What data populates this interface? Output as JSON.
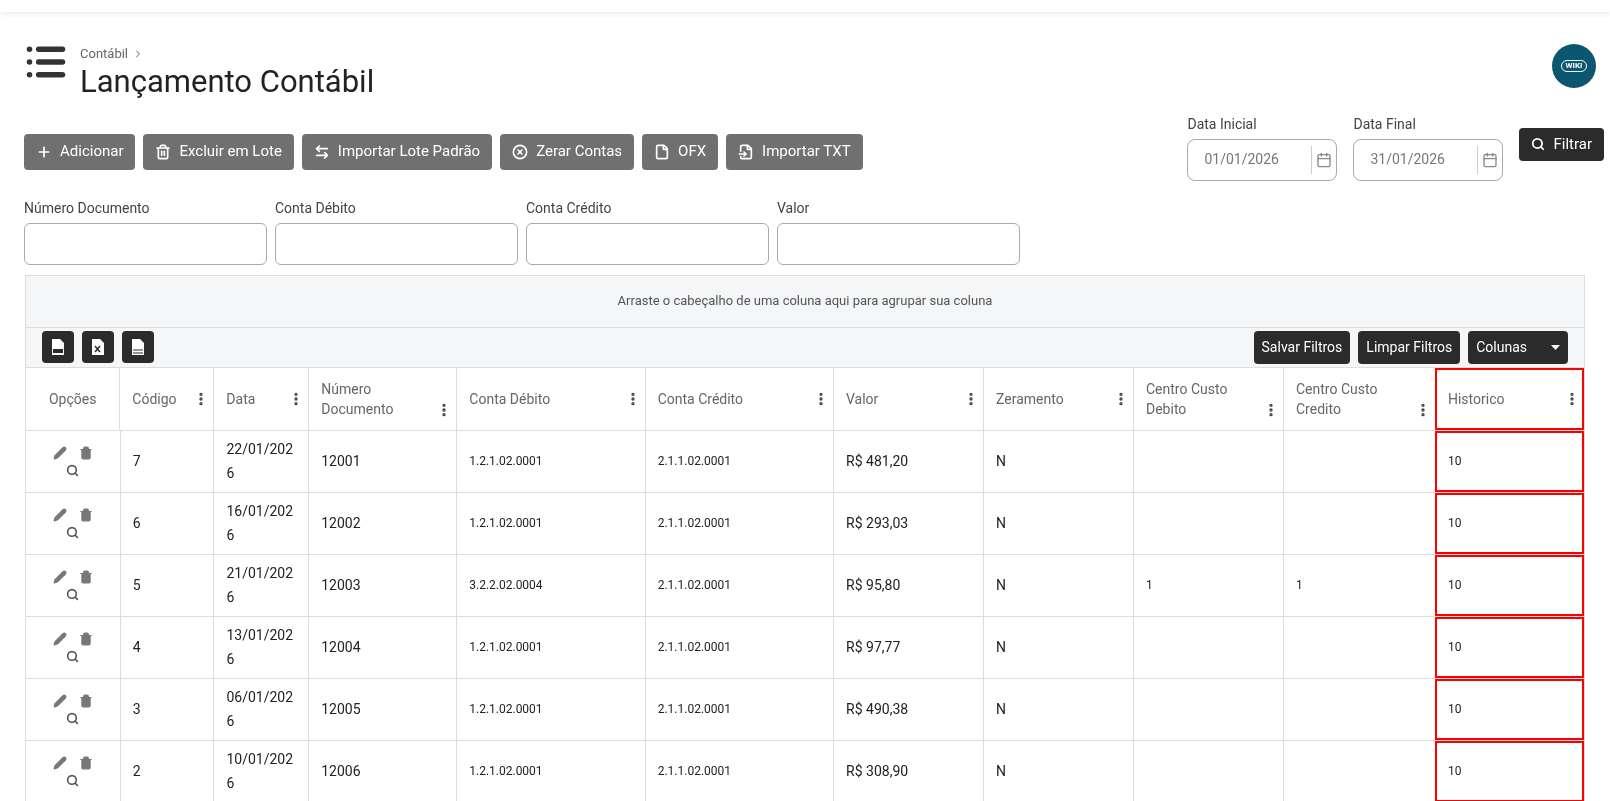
{
  "wiki_logo": "WIKI",
  "breadcrumb": "Contábil",
  "title": "Lançamento Contábil",
  "actions": [
    {
      "label": "Adicionar",
      "kind": "plus"
    },
    {
      "label": "Excluir em Lote",
      "kind": "trash"
    },
    {
      "label": "Importar Lote Padrão",
      "kind": "swap"
    },
    {
      "label": "Zerar Contas",
      "kind": "clear"
    },
    {
      "label": "OFX",
      "kind": "file"
    },
    {
      "label": "Importar TXT",
      "kind": "import"
    }
  ],
  "date_filters": [
    {
      "label": "Data Inicial",
      "value": "01/01/2026"
    },
    {
      "label": "Data Final",
      "value": "31/01/2026"
    }
  ],
  "filter_button": "Filtrar",
  "filters": [
    {
      "label": "Número Documento"
    },
    {
      "label": "Conta Débito"
    },
    {
      "label": "Conta Crédito"
    },
    {
      "label": "Valor"
    }
  ],
  "group_hint": "Arraste o cabeçalho de uma coluna aqui para agrupar sua coluna",
  "exports": [
    {
      "kind": "pdf"
    },
    {
      "kind": "xls"
    },
    {
      "kind": "csv"
    }
  ],
  "grid_buttons": [
    "Salvar Filtros",
    "Limpar Filtros"
  ],
  "columns_button": "Colunas",
  "table": {
    "columns": [
      {
        "label": "Opções",
        "menu": false,
        "highlighted": false
      },
      {
        "label": "Código",
        "menu": true,
        "highlighted": false
      },
      {
        "label": "Data",
        "menu": true,
        "highlighted": false
      },
      {
        "label": "Número Documento",
        "menu": true,
        "highlighted": false
      },
      {
        "label": "Conta Débito",
        "menu": true,
        "highlighted": false
      },
      {
        "label": "Conta Crédito",
        "menu": true,
        "highlighted": false
      },
      {
        "label": "Valor",
        "menu": true,
        "highlighted": false
      },
      {
        "label": "Zeramento",
        "menu": true,
        "highlighted": false
      },
      {
        "label": "Centro Custo Debito",
        "menu": true,
        "highlighted": false
      },
      {
        "label": "Centro Custo Credito",
        "menu": true,
        "highlighted": false
      },
      {
        "label": "Historico",
        "menu": true,
        "highlighted": true
      }
    ],
    "rows": [
      [
        "",
        "7",
        "22/01/2026",
        "12001",
        "1.2.1.02.0001",
        "2.1.1.02.0001",
        "R$ 481,20",
        "N",
        "",
        "",
        "10"
      ],
      [
        "",
        "6",
        "16/01/2026",
        "12002",
        "1.2.1.02.0001",
        "2.1.1.02.0001",
        "R$ 293,03",
        "N",
        "",
        "",
        "10"
      ],
      [
        "",
        "5",
        "21/01/2026",
        "12003",
        "3.2.2.02.0004",
        "2.1.1.02.0001",
        "R$ 95,80",
        "N",
        "1",
        "1",
        "10"
      ],
      [
        "",
        "4",
        "13/01/2026",
        "12004",
        "1.2.1.02.0001",
        "2.1.1.02.0001",
        "R$ 97,77",
        "N",
        "",
        "",
        "10"
      ],
      [
        "",
        "3",
        "06/01/2026",
        "12005",
        "1.2.1.02.0001",
        "2.1.1.02.0001",
        "R$ 490,38",
        "N",
        "",
        "",
        "10"
      ],
      [
        "",
        "2",
        "10/01/2026",
        "12006",
        "1.2.1.02.0001",
        "2.1.1.02.0001",
        "R$ 308,90",
        "N",
        "",
        "",
        "10"
      ]
    ]
  }
}
